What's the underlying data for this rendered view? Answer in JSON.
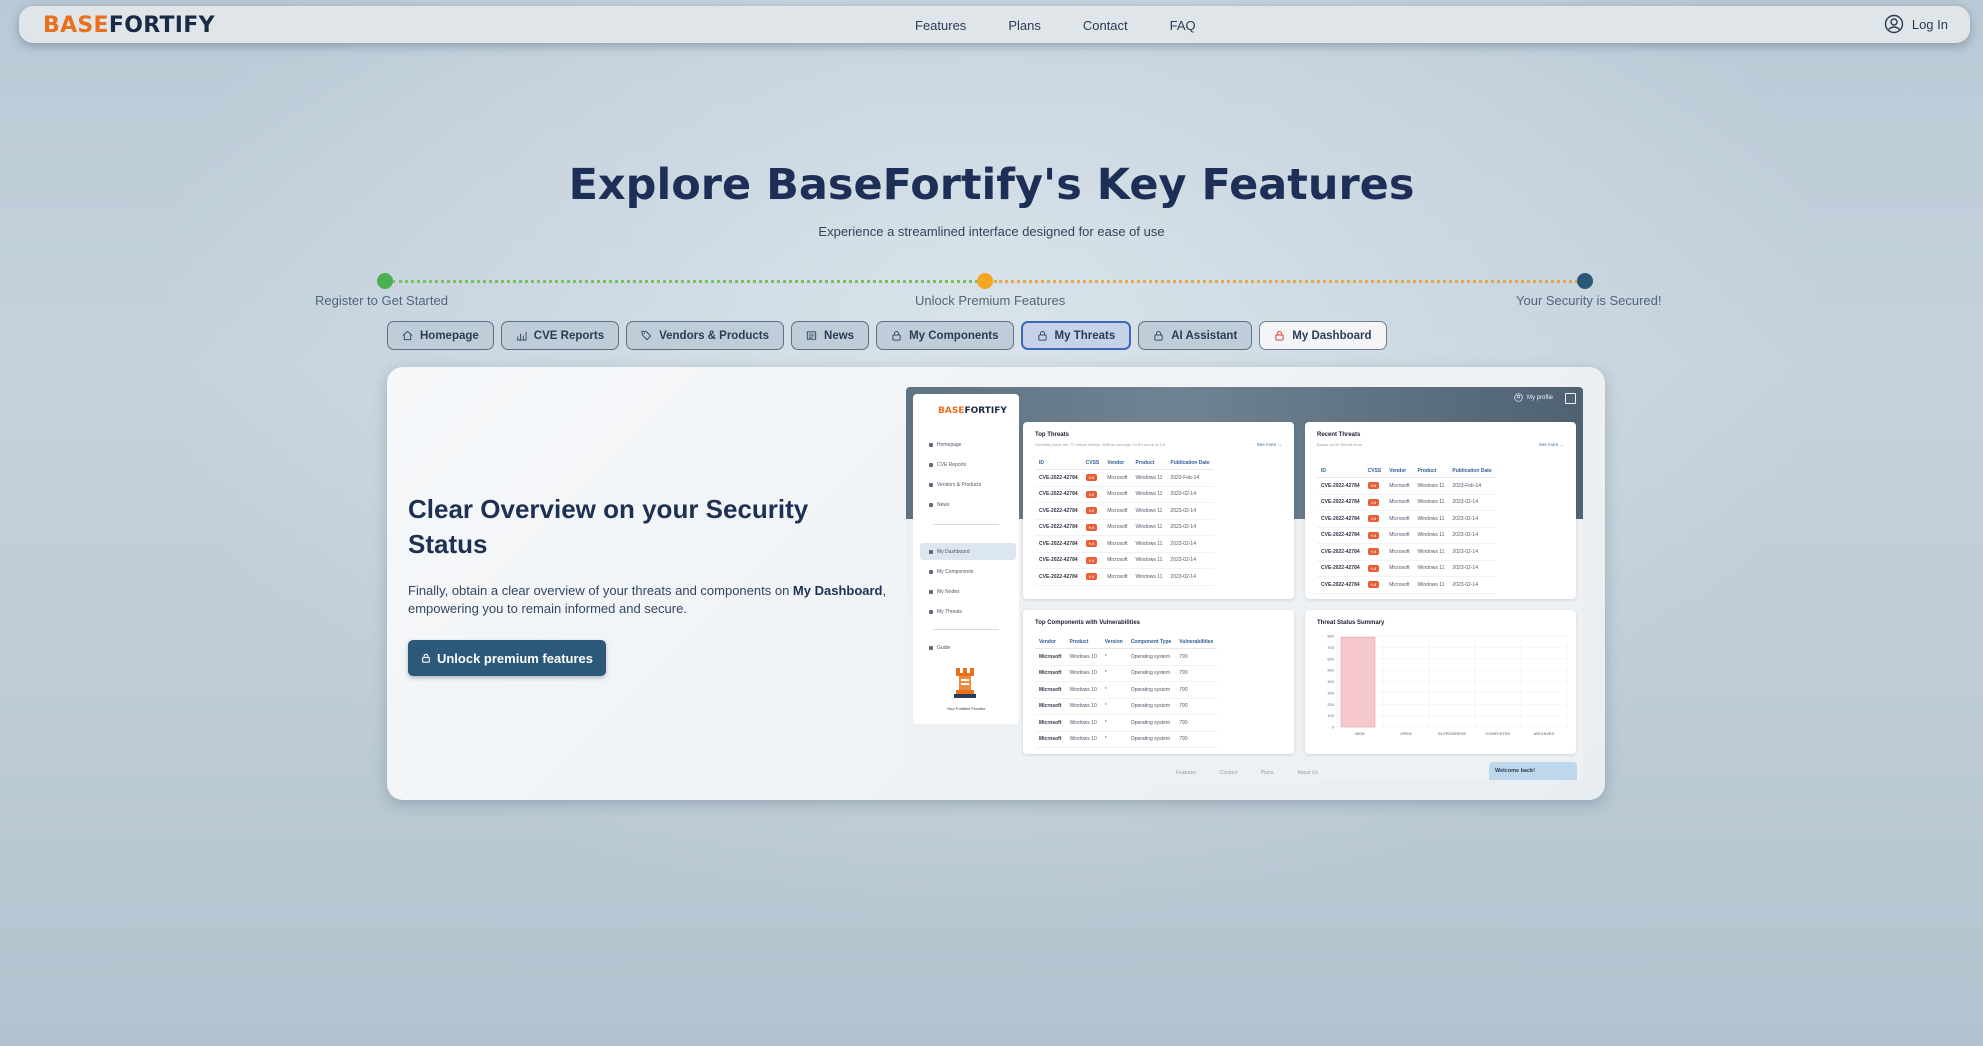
{
  "nav": {
    "logo_part1": "BASE",
    "logo_part2": "FORTIFY",
    "links": [
      "Features",
      "Plans",
      "Contact",
      "FAQ"
    ],
    "login": "Log In"
  },
  "hero": {
    "title": "Explore BaseFortify's Key Features",
    "subtitle": "Experience a streamlined interface designed for ease of use"
  },
  "steps": [
    {
      "label": "Register to Get Started",
      "color": "#4caf50"
    },
    {
      "label": "Unlock Premium Features",
      "color": "#f5a623"
    },
    {
      "label": "Your Security is Secured!",
      "color": "#2c5877"
    }
  ],
  "tabs": [
    {
      "label": "Homepage",
      "icon": "home-icon"
    },
    {
      "label": "CVE Reports",
      "icon": "bar-chart-icon"
    },
    {
      "label": "Vendors & Products",
      "icon": "tags-icon"
    },
    {
      "label": "News",
      "icon": "newspaper-icon"
    },
    {
      "label": "My Components",
      "icon": "lock-icon"
    },
    {
      "label": "My Threats",
      "icon": "lock-icon",
      "state": "selected"
    },
    {
      "label": "AI Assistant",
      "icon": "lock-icon"
    },
    {
      "label": "My Dashboard",
      "icon": "lock-icon-red",
      "state": "highlighted"
    }
  ],
  "feature": {
    "title": "Clear Overview on your Security Status",
    "text_before": "Finally, obtain a clear overview of your threats and components on ",
    "text_bold": "My Dashboard",
    "text_after": ", empowering you to remain informed and secure.",
    "button": "Unlock premium features"
  },
  "preview": {
    "logo_part1": "BASE",
    "logo_part2": "FORTIFY",
    "profile": "My profile",
    "sidebar": [
      "Homepage",
      "CVE Reports",
      "Vendors & Products",
      "News",
      "My Dashboard",
      "My Components",
      "My Nodes",
      "My Threats",
      "Guide"
    ],
    "mascot_label": "Your Fortified Frontier",
    "top_threats": {
      "title": "Top Threats",
      "subtitle": "Currently there are 77 critical threats. With an average CVSS score of 8.8",
      "see_more": "See more →",
      "columns": [
        "ID",
        "CVSS",
        "Vendor",
        "Product",
        "Publication Date"
      ],
      "rows": [
        [
          "CVE-2022-42784",
          "9.8",
          "Microsoft",
          "Windows 11",
          "2023-Feb-14"
        ],
        [
          "CVE-2022-42784",
          "9.8",
          "Microsoft",
          "Windows 11",
          "2023-02-14"
        ],
        [
          "CVE-2022-42784",
          "9.8",
          "Microsoft",
          "Windows 11",
          "2023-02-14"
        ],
        [
          "CVE-2022-42784",
          "9.8",
          "Microsoft",
          "Windows 11",
          "2023-02-14"
        ],
        [
          "CVE-2022-42784",
          "9.8",
          "Microsoft",
          "Windows 11",
          "2023-02-14"
        ],
        [
          "CVE-2022-42784",
          "9.8",
          "Microsoft",
          "Windows 11",
          "2023-02-14"
        ],
        [
          "CVE-2022-42784",
          "9.8",
          "Microsoft",
          "Windows 11",
          "2023-02-14"
        ]
      ]
    },
    "recent_threats": {
      "title": "Recent Threats",
      "subtitle": "Based on 82 threats from",
      "see_more": "See more →",
      "columns": [
        "ID",
        "CVSS",
        "Vendor",
        "Product",
        "Publication Date"
      ],
      "rows": [
        [
          "CVE-2022-42784",
          "9.8",
          "Microsoft",
          "Windows 11",
          "2023-Feb-14"
        ],
        [
          "CVE-2022-42784",
          "9.8",
          "Microsoft",
          "Windows 11",
          "2023-02-14"
        ],
        [
          "CVE-2022-42784",
          "9.8",
          "Microsoft",
          "Windows 11",
          "2023-02-14"
        ],
        [
          "CVE-2022-42784",
          "9.8",
          "Microsoft",
          "Windows 11",
          "2023-02-14"
        ],
        [
          "CVE-2022-42784",
          "9.8",
          "Microsoft",
          "Windows 11",
          "2023-02-14"
        ],
        [
          "CVE-2022-42784",
          "9.8",
          "Microsoft",
          "Windows 11",
          "2023-02-14"
        ],
        [
          "CVE-2022-42784",
          "9.8",
          "Microsoft",
          "Windows 11",
          "2023-02-14"
        ]
      ]
    },
    "components": {
      "title": "Top Components with Vulnerabilities",
      "columns": [
        "Vendor",
        "Product",
        "Version",
        "Component Type",
        "Vulnerabilities"
      ],
      "rows": [
        [
          "Microsoft",
          "Windows 10",
          "*",
          "Operating system",
          "790"
        ],
        [
          "Microsoft",
          "Windows 10",
          "*",
          "Operating system",
          "790"
        ],
        [
          "Microsoft",
          "Windows 10",
          "*",
          "Operating system",
          "790"
        ],
        [
          "Microsoft",
          "Windows 10",
          "*",
          "Operating system",
          "790"
        ],
        [
          "Microsoft",
          "Windows 10",
          "*",
          "Operating system",
          "790"
        ],
        [
          "Microsoft",
          "Windows 10",
          "*",
          "Operating system",
          "790"
        ]
      ]
    },
    "footer_links": [
      "Features",
      "Contact",
      "Plans",
      "About Us"
    ],
    "welcome": "Welcome back!"
  },
  "chart_data": {
    "type": "bar",
    "title": "Threat Status Summary",
    "categories": [
      "NEW",
      "OPEN",
      "IN PROGRESS",
      "COMPLETED",
      "ARCHIVED"
    ],
    "values": [
      790,
      0,
      0,
      0,
      0
    ],
    "ylim": [
      0,
      800
    ],
    "yticks": [
      "800",
      "700",
      "600",
      "500",
      "400",
      "300",
      "200",
      "100",
      "0"
    ],
    "bar_color": "#f7c7cf",
    "bar_border_color": "#e8a3ae",
    "grid": true
  }
}
